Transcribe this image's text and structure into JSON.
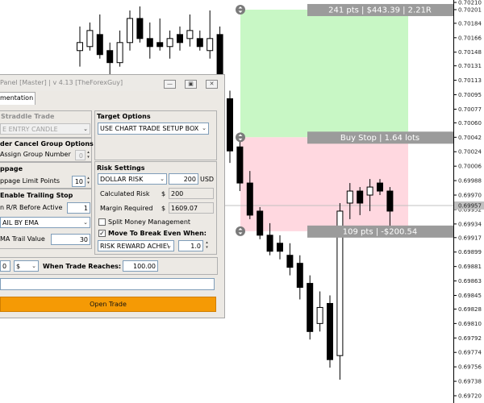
{
  "chart_data": {
    "type": "candlestick",
    "price_axis_labels": [
      "0.70210",
      "0.70201",
      "0.70184",
      "0.70166",
      "0.70148",
      "0.70131",
      "0.70113",
      "0.70095",
      "0.70077",
      "0.70060",
      "0.70042",
      "0.70024",
      "0.70006",
      "0.69988",
      "0.69970",
      "0.69952",
      "0.69934",
      "0.69917",
      "0.69899",
      "0.69881",
      "0.69863",
      "0.69845",
      "0.69828",
      "0.69810",
      "0.69792",
      "0.69774",
      "0.69756",
      "0.69738",
      "0.69720"
    ],
    "current_price": "0.69957",
    "ylim": [
      0.6972,
      0.7021
    ],
    "candles": [
      {
        "o": 0.7015,
        "h": 0.7018,
        "l": 0.7013,
        "c": 0.7016
      },
      {
        "o": 0.70155,
        "h": 0.70185,
        "l": 0.7015,
        "c": 0.70175
      },
      {
        "o": 0.7017,
        "h": 0.70195,
        "l": 0.7014,
        "c": 0.70145
      },
      {
        "o": 0.7015,
        "h": 0.7016,
        "l": 0.7012,
        "c": 0.70135
      },
      {
        "o": 0.70135,
        "h": 0.70175,
        "l": 0.7013,
        "c": 0.7016
      },
      {
        "o": 0.7016,
        "h": 0.702,
        "l": 0.7015,
        "c": 0.7019
      },
      {
        "o": 0.7019,
        "h": 0.70205,
        "l": 0.7016,
        "c": 0.70165
      },
      {
        "o": 0.70165,
        "h": 0.70185,
        "l": 0.7014,
        "c": 0.70155
      },
      {
        "o": 0.7016,
        "h": 0.7019,
        "l": 0.7015,
        "c": 0.70155
      },
      {
        "o": 0.70155,
        "h": 0.70175,
        "l": 0.7014,
        "c": 0.70165
      },
      {
        "o": 0.7017,
        "h": 0.7018,
        "l": 0.7015,
        "c": 0.7016
      },
      {
        "o": 0.70165,
        "h": 0.70195,
        "l": 0.70155,
        "c": 0.70175
      },
      {
        "o": 0.70165,
        "h": 0.70175,
        "l": 0.7015,
        "c": 0.70155
      },
      {
        "o": 0.7015,
        "h": 0.702,
        "l": 0.7014,
        "c": 0.70165
      },
      {
        "o": 0.7017,
        "h": 0.7018,
        "l": 0.701,
        "c": 0.7011
      },
      {
        "o": 0.7009,
        "h": 0.701,
        "l": 0.7001,
        "c": 0.70025
      },
      {
        "o": 0.7003,
        "h": 0.7004,
        "l": 0.69975,
        "c": 0.69985
      },
      {
        "o": 0.69985,
        "h": 0.7,
        "l": 0.6994,
        "c": 0.69945
      },
      {
        "o": 0.6995,
        "h": 0.69955,
        "l": 0.69915,
        "c": 0.6992
      },
      {
        "o": 0.6992,
        "h": 0.69935,
        "l": 0.69895,
        "c": 0.699
      },
      {
        "o": 0.6991,
        "h": 0.6992,
        "l": 0.6989,
        "c": 0.699
      },
      {
        "o": 0.69895,
        "h": 0.6991,
        "l": 0.6987,
        "c": 0.6988
      },
      {
        "o": 0.69885,
        "h": 0.69895,
        "l": 0.6984,
        "c": 0.69855
      },
      {
        "o": 0.6986,
        "h": 0.6987,
        "l": 0.6979,
        "c": 0.698
      },
      {
        "o": 0.6981,
        "h": 0.6985,
        "l": 0.698,
        "c": 0.6983
      },
      {
        "o": 0.69835,
        "h": 0.69845,
        "l": 0.69755,
        "c": 0.69765
      },
      {
        "o": 0.6977,
        "h": 0.6996,
        "l": 0.6974,
        "c": 0.6995
      },
      {
        "o": 0.6996,
        "h": 0.69985,
        "l": 0.6994,
        "c": 0.69975
      },
      {
        "o": 0.69975,
        "h": 0.6998,
        "l": 0.69945,
        "c": 0.6996
      },
      {
        "o": 0.6997,
        "h": 0.6999,
        "l": 0.6995,
        "c": 0.6998
      },
      {
        "o": 0.69985,
        "h": 0.6999,
        "l": 0.6997,
        "c": 0.69975
      },
      {
        "o": 0.69975,
        "h": 0.6998,
        "l": 0.6993,
        "c": 0.6995
      }
    ],
    "zones": {
      "take_profit": {
        "top": 0.70201,
        "bottom": 0.70042,
        "color": "#c8f7c5",
        "label": "241 pts | $443.39 | 2.21R"
      },
      "stop_loss": {
        "top": 0.70042,
        "bottom": 0.69925,
        "color": "#ffd8e0",
        "label": "109 pts | -$200.54"
      },
      "entry": {
        "label": "Buy Stop | 1.64 lots"
      }
    }
  },
  "panel": {
    "title": "Panel [Master] | v 4.13 [TheForexGuy]",
    "tab_label": "mentation",
    "straddle_title": "Straddle Trade",
    "straddle_select": "E ENTRY CANDLE",
    "ocg_title": "der Cancel Group Options",
    "assign_group_label": "Assign Group Number",
    "assign_group_value": "0",
    "slippage_title": "ppage",
    "slippage_label": "ppage Limit Points",
    "slippage_value": "10",
    "trailing_title": "Enable Trailing Stop",
    "rr_label": "n R/R Before Active",
    "rr_value": "1",
    "trail_select": "AIL BY EMA",
    "ema_label": "MA Trail Value",
    "ema_value": "30",
    "target_title": "Target Options",
    "target_select": "USE CHART TRADE SETUP BOX",
    "risk_title": "Risk Settings",
    "risk_select": "DOLLAR RISK",
    "risk_value": "200",
    "risk_unit": "USD",
    "calc_risk_label": "Calculated Risk",
    "calc_risk_currency": "$",
    "calc_risk_value": "200",
    "margin_label": "Margin Required",
    "margin_currency": "$",
    "margin_value": "1609.07",
    "split_label": "Split Money Management",
    "split_checked": "",
    "breakeven_label": "Move To Break Even When:",
    "breakeven_checked": "✓",
    "breakeven_select": "RISK REWARD ACHIE\\",
    "breakeven_value": "1.0",
    "bottom_num": "0",
    "bottom_currency": "$",
    "trade_reaches_label": "When Trade Reaches: $",
    "trade_reaches_value": "100.00",
    "open_trade": "Open Trade",
    "btn_min": "—",
    "btn_max": "▣",
    "btn_close": "✕"
  }
}
